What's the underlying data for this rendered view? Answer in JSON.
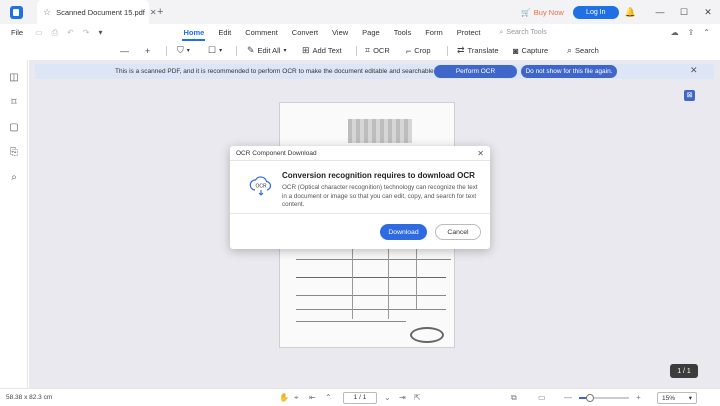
{
  "titlebar": {
    "tab_title": "Scanned Document 15.pdf",
    "buy_now": "Buy Now",
    "login": "Log In"
  },
  "menubar": {
    "file": "File",
    "tabs": [
      "Home",
      "Edit",
      "Comment",
      "Convert",
      "View",
      "Page",
      "Tools",
      "Form",
      "Protect"
    ],
    "active_tab": "Home",
    "search_placeholder": "Search Tools"
  },
  "toolbar": {
    "edit_all": "Edit All",
    "add_text": "Add Text",
    "ocr": "OCR",
    "crop": "Crop",
    "translate": "Translate",
    "capture": "Capture",
    "search": "Search"
  },
  "banner": {
    "message": "This is a scanned PDF, and it is recommended to perform OCR to make the document editable and searchable.",
    "perform_ocr": "Perform OCR",
    "dont_show": "Do not show for this file again."
  },
  "dialog": {
    "title": "OCR Component Download",
    "heading": "Conversion recognition requires to download OCR",
    "body": "OCR (Optical character recognition) technology can recognize the text in a document or image so that you can edit, copy, and search for text content.",
    "icon_label": "OCR",
    "download": "Download",
    "cancel": "Cancel"
  },
  "page_badge": "1 / 1",
  "statusbar": {
    "dimensions": "58.38 x 82.3 cm",
    "page_indicator": "1 / 1",
    "zoom": "15%"
  },
  "colors": {
    "accent": "#1f6fe5",
    "banner_button": "#3f66c9",
    "buy_now": "#ef6c3f"
  }
}
